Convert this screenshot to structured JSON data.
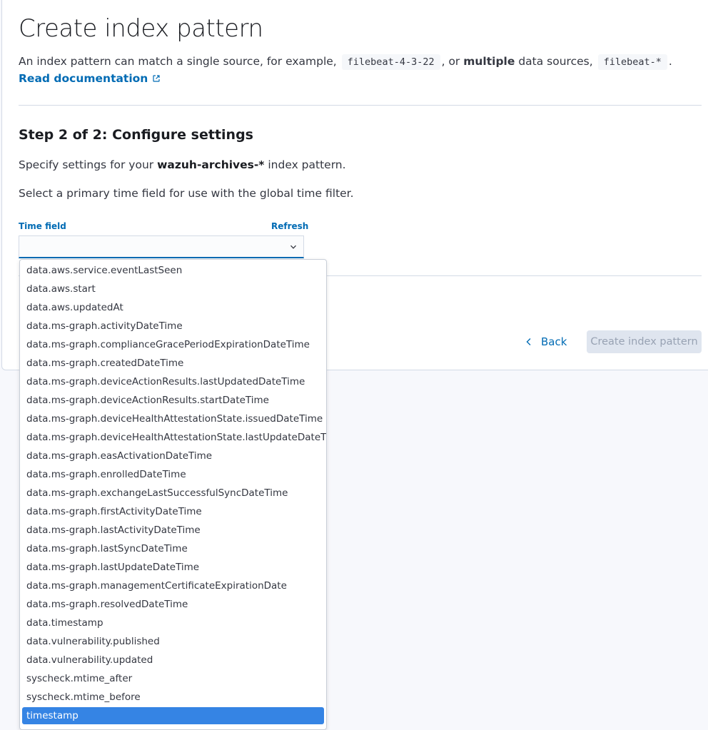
{
  "page": {
    "title": "Create index pattern",
    "intro": {
      "text1": "An index pattern can match a single source, for example, ",
      "code1": "filebeat-4-3-22",
      "text2": ", or ",
      "bold": "multiple",
      "text3": " data sources, ",
      "code2": "filebeat-*",
      "text4": "."
    },
    "doc_link": "Read documentation"
  },
  "step": {
    "title": "Step 2 of 2: Configure settings",
    "specify_prefix": "Specify settings for your ",
    "pattern_name": "wazuh-archives-*",
    "specify_suffix": " index pattern.",
    "select_text": "Select a primary time field for use with the global time filter."
  },
  "time_field": {
    "label": "Time field",
    "refresh": "Refresh",
    "value": "",
    "options": [
      "data.aws.service.eventLastSeen",
      "data.aws.start",
      "data.aws.updatedAt",
      "data.ms-graph.activityDateTime",
      "data.ms-graph.complianceGracePeriodExpirationDateTime",
      "data.ms-graph.createdDateTime",
      "data.ms-graph.deviceActionResults.lastUpdatedDateTime",
      "data.ms-graph.deviceActionResults.startDateTime",
      "data.ms-graph.deviceHealthAttestationState.issuedDateTime",
      "data.ms-graph.deviceHealthAttestationState.lastUpdateDateTime",
      "data.ms-graph.easActivationDateTime",
      "data.ms-graph.enrolledDateTime",
      "data.ms-graph.exchangeLastSuccessfulSyncDateTime",
      "data.ms-graph.firstActivityDateTime",
      "data.ms-graph.lastActivityDateTime",
      "data.ms-graph.lastSyncDateTime",
      "data.ms-graph.lastUpdateDateTime",
      "data.ms-graph.managementCertificateExpirationDate",
      "data.ms-graph.resolvedDateTime",
      "data.timestamp",
      "data.vulnerability.published",
      "data.vulnerability.updated",
      "syscheck.mtime_after",
      "syscheck.mtime_before",
      "timestamp"
    ],
    "highlighted": "timestamp"
  },
  "actions": {
    "back": "Back",
    "create": "Create index pattern"
  },
  "icons": {
    "external": "external-link-icon",
    "chevron": "chevron-down-icon",
    "back": "arrow-left-icon"
  },
  "colors": {
    "link": "#006bb4",
    "selected_option": "#3584e4",
    "disabled_button": "#dfe5ef"
  }
}
